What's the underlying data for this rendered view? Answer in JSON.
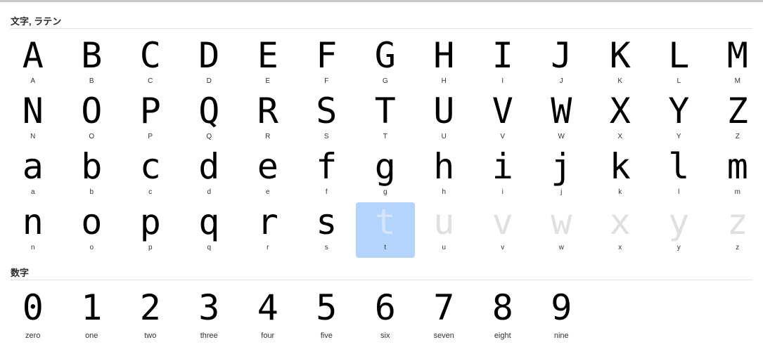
{
  "sections": {
    "latin": {
      "title": "文字, ラテン"
    },
    "digits": {
      "title": "数字"
    }
  },
  "latin_glyphs": [
    {
      "glyph": "A",
      "label": "A"
    },
    {
      "glyph": "B",
      "label": "B"
    },
    {
      "glyph": "C",
      "label": "C"
    },
    {
      "glyph": "D",
      "label": "D"
    },
    {
      "glyph": "E",
      "label": "E"
    },
    {
      "glyph": "F",
      "label": "F"
    },
    {
      "glyph": "G",
      "label": "G"
    },
    {
      "glyph": "H",
      "label": "H"
    },
    {
      "glyph": "I",
      "label": "I"
    },
    {
      "glyph": "J",
      "label": "J"
    },
    {
      "glyph": "K",
      "label": "K"
    },
    {
      "glyph": "L",
      "label": "L"
    },
    {
      "glyph": "M",
      "label": "M"
    },
    {
      "glyph": "N",
      "label": "N"
    },
    {
      "glyph": "O",
      "label": "O"
    },
    {
      "glyph": "P",
      "label": "P"
    },
    {
      "glyph": "Q",
      "label": "Q"
    },
    {
      "glyph": "R",
      "label": "R"
    },
    {
      "glyph": "S",
      "label": "S"
    },
    {
      "glyph": "T",
      "label": "T"
    },
    {
      "glyph": "U",
      "label": "U"
    },
    {
      "glyph": "V",
      "label": "V"
    },
    {
      "glyph": "W",
      "label": "W"
    },
    {
      "glyph": "X",
      "label": "X"
    },
    {
      "glyph": "Y",
      "label": "Y"
    },
    {
      "glyph": "Z",
      "label": "Z"
    },
    {
      "glyph": "a",
      "label": "a"
    },
    {
      "glyph": "b",
      "label": "b"
    },
    {
      "glyph": "c",
      "label": "c"
    },
    {
      "glyph": "d",
      "label": "d"
    },
    {
      "glyph": "e",
      "label": "e"
    },
    {
      "glyph": "f",
      "label": "f"
    },
    {
      "glyph": "g",
      "label": "g"
    },
    {
      "glyph": "h",
      "label": "h"
    },
    {
      "glyph": "i",
      "label": "i"
    },
    {
      "glyph": "j",
      "label": "j"
    },
    {
      "glyph": "k",
      "label": "k"
    },
    {
      "glyph": "l",
      "label": "l"
    },
    {
      "glyph": "m",
      "label": "m"
    },
    {
      "glyph": "n",
      "label": "n"
    },
    {
      "glyph": "o",
      "label": "o"
    },
    {
      "glyph": "p",
      "label": "p"
    },
    {
      "glyph": "q",
      "label": "q"
    },
    {
      "glyph": "r",
      "label": "r"
    },
    {
      "glyph": "s",
      "label": "s"
    },
    {
      "glyph": "t",
      "label": "t",
      "state": "selected"
    },
    {
      "glyph": "u",
      "label": "u",
      "state": "dim"
    },
    {
      "glyph": "v",
      "label": "v",
      "state": "dim"
    },
    {
      "glyph": "w",
      "label": "w",
      "state": "dim"
    },
    {
      "glyph": "x",
      "label": "x",
      "state": "dim"
    },
    {
      "glyph": "y",
      "label": "y",
      "state": "dim"
    },
    {
      "glyph": "z",
      "label": "z",
      "state": "dim"
    }
  ],
  "digit_glyphs": [
    {
      "glyph": "0",
      "label": "zero"
    },
    {
      "glyph": "1",
      "label": "one"
    },
    {
      "glyph": "2",
      "label": "two"
    },
    {
      "glyph": "3",
      "label": "three"
    },
    {
      "glyph": "4",
      "label": "four"
    },
    {
      "glyph": "5",
      "label": "five"
    },
    {
      "glyph": "6",
      "label": "six"
    },
    {
      "glyph": "7",
      "label": "seven"
    },
    {
      "glyph": "8",
      "label": "eight"
    },
    {
      "glyph": "9",
      "label": "nine"
    }
  ],
  "colors": {
    "selection": "#b3d4fc",
    "glyph": "#000000",
    "dim_glyph": "#e0e0e0"
  }
}
